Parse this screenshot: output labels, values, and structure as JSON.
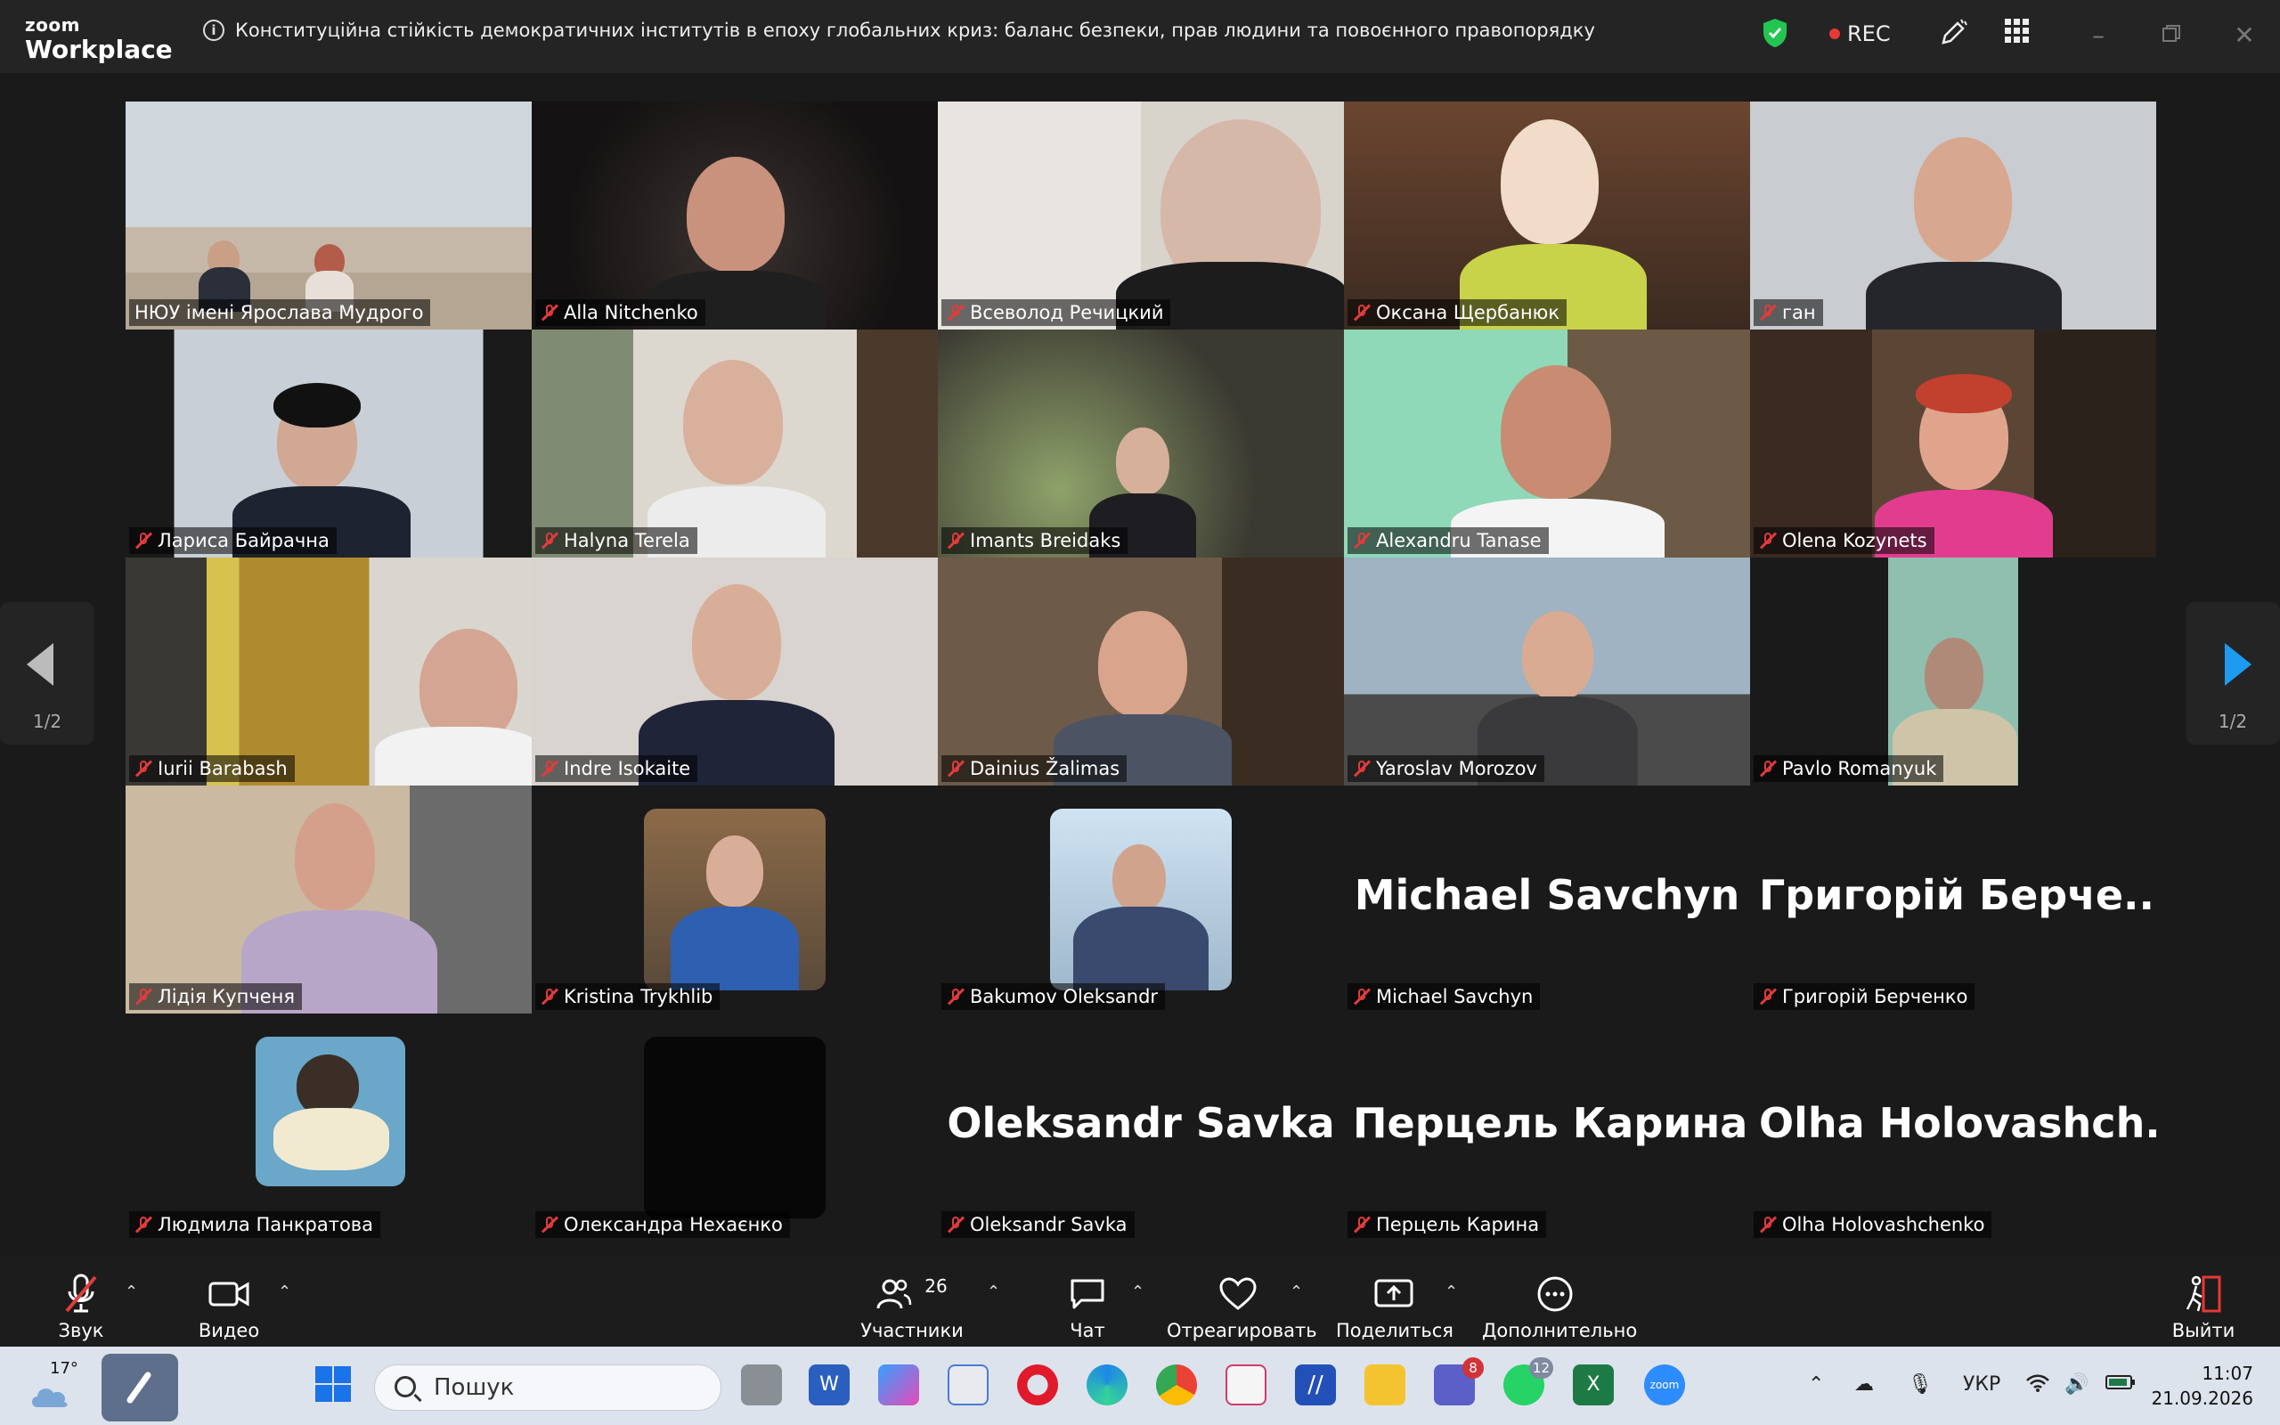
{
  "app": {
    "logo_line1": "zoom",
    "logo_line2": "Workplace",
    "meeting_title": "Конституційна стійкість демократичних інститутів в епоху глобальних криз: баланс безпеки, прав людини та повоєнного правопорядку",
    "rec_label": "REC"
  },
  "pager": {
    "left_page": "1/2",
    "right_page": "1/2"
  },
  "participants": [
    {
      "name": "НЮУ імені Ярослава Мудрого",
      "muted": false,
      "active": true
    },
    {
      "name": "Alla Nitchenko",
      "muted": true
    },
    {
      "name": "Всеволод Речицкий",
      "muted": true
    },
    {
      "name": "Оксана Щербанюк",
      "muted": true
    },
    {
      "name": "ган",
      "muted": true
    },
    {
      "name": "Лариса Байрачна",
      "muted": true
    },
    {
      "name": "Halyna Terela",
      "muted": true
    },
    {
      "name": "Imants Breidaks",
      "muted": true
    },
    {
      "name": "Alexandru Tanase",
      "muted": true
    },
    {
      "name": "Olena Kozynets",
      "muted": true
    },
    {
      "name": "Iurii Barabash",
      "muted": true
    },
    {
      "name": "Indre Isokaite",
      "muted": true
    },
    {
      "name": "Dainius Žalimas",
      "muted": true
    },
    {
      "name": "Yaroslav Morozov",
      "muted": true
    },
    {
      "name": "Pavlo Romanyuk",
      "muted": true
    },
    {
      "name": "Лідія Купченя",
      "muted": true
    },
    {
      "name": "Kristina Trykhlib",
      "muted": true
    },
    {
      "name": "Bakumov Oleksandr",
      "muted": true
    },
    {
      "name": "Michael Savchyn",
      "muted": true,
      "big_name": "Michael Savchyn"
    },
    {
      "name": "Григорій Берченко",
      "muted": true,
      "big_name": "Григорій  Берче..."
    },
    {
      "name": "Людмила Панкратова",
      "muted": true
    },
    {
      "name": "Олександра Нехаєнко",
      "muted": true
    },
    {
      "name": "Oleksandr Savka",
      "muted": true,
      "big_name": "Oleksandr Savka"
    },
    {
      "name": "Перцель Карина",
      "muted": true,
      "big_name": "Перцель Карина"
    },
    {
      "name": "Olha Holovashchenko",
      "muted": true,
      "big_name": "Olha  Holovashch..."
    }
  ],
  "toolbar": {
    "audio_label": "Звук",
    "video_label": "Видео",
    "participants_label": "Участники",
    "participants_count": "26",
    "chat_label": "Чат",
    "react_label": "Отреагировать",
    "share_label": "Поделиться",
    "more_label": "Дополнительно",
    "leave_label": "Выйти"
  },
  "taskbar": {
    "weather_temp": "17°",
    "search_placeholder": "Пошук",
    "teams_badge": "8",
    "whatsapp_badge": "12",
    "language": "УКР",
    "time": "11:07",
    "date": "21.09.2026"
  },
  "colors": {
    "active_speaker": "#2ee07a",
    "muted_icon": "#e23b3b",
    "rec_dot": "#e53935",
    "pager_arrow": "#1e9bf0"
  }
}
